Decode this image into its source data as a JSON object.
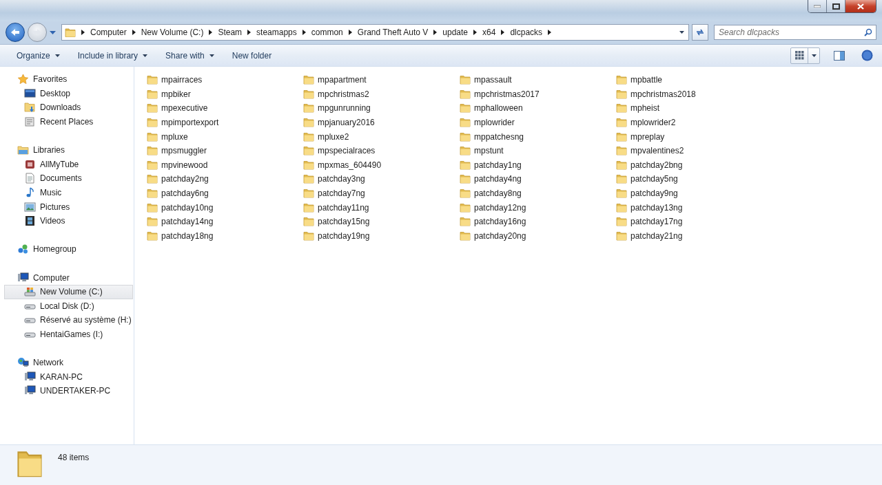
{
  "address_bar": {
    "breadcrumbs": [
      "Computer",
      "New Volume (C:)",
      "Steam",
      "steamapps",
      "common",
      "Grand Theft Auto V",
      "update",
      "x64",
      "dlcpacks"
    ]
  },
  "search": {
    "placeholder": "Search dlcpacks"
  },
  "toolbar": {
    "buttons": [
      {
        "label": "Organize",
        "dropdown": true
      },
      {
        "label": "Include in library",
        "dropdown": true
      },
      {
        "label": "Share with",
        "dropdown": true
      },
      {
        "label": "New folder",
        "dropdown": false
      }
    ]
  },
  "sidebar": {
    "groups": [
      {
        "label": "Favorites",
        "kind": "star",
        "items": [
          {
            "label": "Desktop",
            "kind": "desktop",
            "selected": false
          },
          {
            "label": "Downloads",
            "kind": "downloads",
            "selected": false
          },
          {
            "label": "Recent Places",
            "kind": "recent",
            "selected": false
          }
        ]
      },
      {
        "label": "Libraries",
        "kind": "library",
        "items": [
          {
            "label": "AllMyTube",
            "kind": "app",
            "selected": false
          },
          {
            "label": "Documents",
            "kind": "document",
            "selected": false
          },
          {
            "label": "Music",
            "kind": "music",
            "selected": false
          },
          {
            "label": "Pictures",
            "kind": "picture",
            "selected": false
          },
          {
            "label": "Videos",
            "kind": "video",
            "selected": false
          }
        ]
      },
      {
        "label": "Homegroup",
        "kind": "homegroup"
      },
      {
        "label": "Computer",
        "kind": "computer",
        "items": [
          {
            "label": "New Volume (C:)",
            "kind": "system-drive",
            "selected": true
          },
          {
            "label": "Local Disk (D:)",
            "kind": "drive",
            "selected": false
          },
          {
            "label": "Réservé au système (H:)",
            "kind": "drive",
            "selected": false
          },
          {
            "label": "HentaiGames (I:)",
            "kind": "drive",
            "selected": false
          }
        ]
      },
      {
        "label": "Network",
        "kind": "network",
        "items": [
          {
            "label": "KARAN-PC",
            "kind": "computer",
            "selected": false
          },
          {
            "label": "UNDERTAKER-PC",
            "kind": "computer",
            "selected": false
          }
        ]
      }
    ]
  },
  "files": [
    "mpairraces",
    "mpapartment",
    "mpassault",
    "mpbattle",
    "mpbiker",
    "mpchristmas2",
    "mpchristmas2017",
    "mpchristmas2018",
    "mpexecutive",
    "mpgunrunning",
    "mphalloween",
    "mpheist",
    "mpimportexport",
    "mpjanuary2016",
    "mplowrider",
    "mplowrider2",
    "mpluxe",
    "mpluxe2",
    "mppatchesng",
    "mpreplay",
    "mpsmuggler",
    "mpspecialraces",
    "mpstunt",
    "mpvalentines2",
    "mpvinewood",
    "mpxmas_604490",
    "patchday1ng",
    "patchday2bng",
    "patchday2ng",
    "patchday3ng",
    "patchday4ng",
    "patchday5ng",
    "patchday6ng",
    "patchday7ng",
    "patchday8ng",
    "patchday9ng",
    "patchday10ng",
    "patchday11ng",
    "patchday12ng",
    "patchday13ng",
    "patchday14ng",
    "patchday15ng",
    "patchday16ng",
    "patchday17ng",
    "patchday18ng",
    "patchday19ng",
    "patchday20ng",
    "patchday21ng"
  ],
  "status_bar": {
    "count": "48 items"
  }
}
